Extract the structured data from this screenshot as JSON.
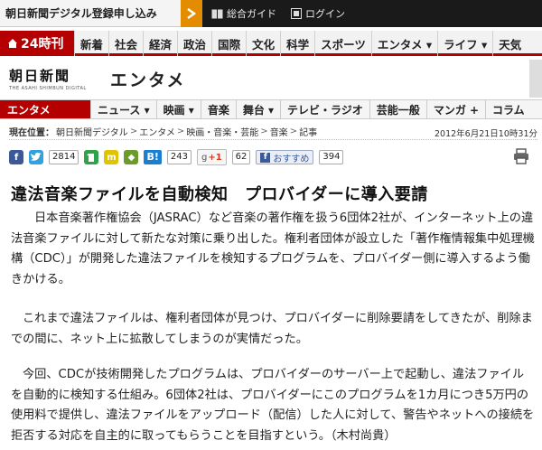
{
  "topbar": {
    "signup_label": "朝日新聞デジタル登録申し込み",
    "links": [
      {
        "icon": "book-icon",
        "label": "総合ガイド"
      },
      {
        "icon": "login-icon",
        "label": "ログイン"
      }
    ]
  },
  "section_nav": {
    "brand": "24時刊",
    "items": [
      "新着",
      "社会",
      "経済",
      "政治",
      "国際",
      "文化",
      "科学",
      "スポーツ",
      "エンタメ ▾",
      "ライフ ▾",
      "天気"
    ]
  },
  "logo": {
    "main": "朝日新聞",
    "sub": "THE ASAHI SHIMBUN DIGITAL",
    "section_title": "エンタメ"
  },
  "sub_nav": {
    "current": "エンタメ",
    "items": [
      "ニュース ▾",
      "映画 ▾",
      "音楽",
      "舞台 ▾",
      "テレビ・ラジオ",
      "芸能一般",
      "マンガ +",
      "コラム"
    ]
  },
  "breadcrumb": {
    "lead": "現在位置：",
    "items": [
      "朝日新聞デジタル",
      "エンタメ",
      "映画・音楽・芸能",
      "音楽",
      "記事"
    ],
    "date": "2012年6月21日10時31分"
  },
  "social": {
    "twitter_count": "2814",
    "hatena_label": "B!",
    "hatena_count": "243",
    "gplus_label": "+1",
    "gplus_count": "62",
    "fb_label": "おすすめ",
    "fb_count": "394"
  },
  "article": {
    "headline": "違法音楽ファイルを自動検知　プロバイダーに導入要請",
    "paragraphs": [
      "日本音楽著作権協会（JASRAC）など音楽の著作権を扱う6団体2社が、インターネット上の違法音楽ファイルに対して新たな対策に乗り出した。権利者団体が設立した「著作権情報集中処理機構（CDC）」が開発した違法ファイルを検知するプログラムを、プロバイダー側に導入するよう働きかける。",
      "これまで違法ファイルは、権利者団体が見つけ、プロバイダーに削除要請をしてきたが、削除までの間に、ネット上に拡散してしまうのが実情だった。",
      "今回、CDCが技術開発したプログラムは、プロバイダーのサーバー上で起動し、違法ファイルを自動的に検知する仕組み。6団体2社は、プロバイダーにこのプログラムを1カ月につき5万円の使用料で提供し、違法ファイルをアップロード（配信）した人に対して、警告やネットへの接続を拒否する対応を自主的に取ってもらうことを目指すという。（木村尚貴）"
    ]
  },
  "colors": {
    "brand_red": "#b40000",
    "topbar": "#1a1a1a",
    "signup_arrow": "#e48c00"
  }
}
